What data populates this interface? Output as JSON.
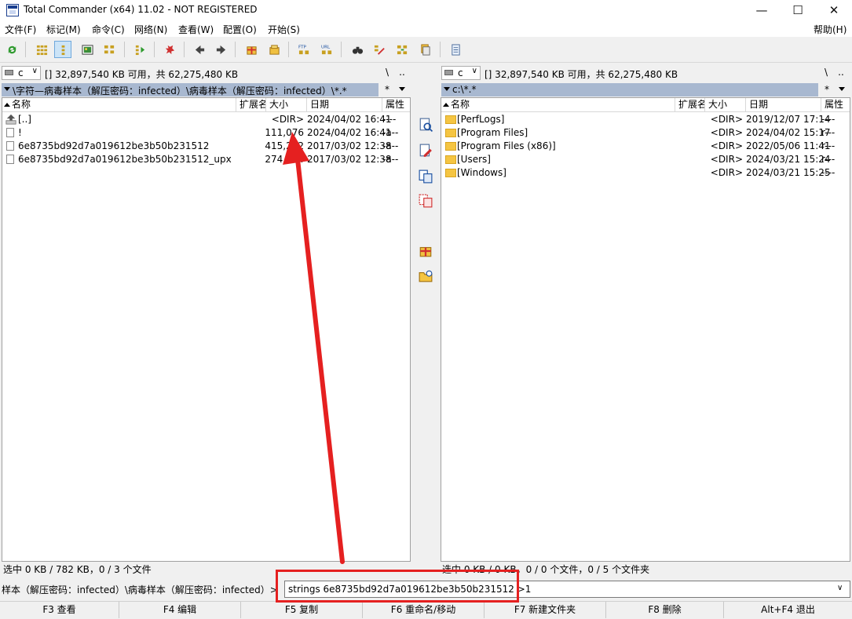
{
  "window": {
    "title": "Total Commander (x64) 11.02 - NOT REGISTERED",
    "minimize": "—",
    "maximize": "☐",
    "close": "✕"
  },
  "menu": {
    "items": [
      "文件(F)",
      "标记(M)",
      "命令(C)",
      "网络(N)",
      "查看(W)",
      "配置(O)",
      "开始(S)"
    ],
    "help": "帮助(H)"
  },
  "left": {
    "drive": "c",
    "free_space": "[]  32,897,540 KB 可用，共 62,275,480 KB",
    "root": "\\",
    "up": "..",
    "path": "\\字符—病毒样本（解压密码：infected）\\病毒样本（解压密码：infected）\\*.*",
    "filter": "*",
    "columns": {
      "name": "名称",
      "ext": "扩展名",
      "size": "大小",
      "date": "日期",
      "attr": "属性"
    },
    "files": [
      {
        "name": "[..]",
        "size": "<DIR>",
        "date": "2024/04/02 16:41",
        "attr": "----",
        "icon": "up-folder-icon"
      },
      {
        "name": "!",
        "size": "111,076",
        "date": "2024/04/02 16:41",
        "attr": "-a--",
        "icon": "file-icon"
      },
      {
        "name": "6e8735bd92d7a019612be3b50b231512",
        "size": "415,232",
        "date": "2017/03/02 12:38",
        "attr": "-a--",
        "icon": "file-icon"
      },
      {
        "name": "6e8735bd92d7a019612be3b50b231512_upx",
        "size": "274,944",
        "date": "2017/03/02 12:38",
        "attr": "-a--",
        "icon": "file-icon"
      }
    ],
    "status": "选中 0 KB / 782 KB，0 / 3 个文件"
  },
  "right": {
    "drive": "c",
    "free_space": "[]  32,897,540 KB 可用，共 62,275,480 KB",
    "root": "\\",
    "up": "..",
    "path": "c:\\*.*",
    "filter": "*",
    "columns": {
      "name": "名称",
      "ext": "扩展名",
      "size": "大小",
      "date": "日期",
      "attr": "属性"
    },
    "files": [
      {
        "name": "[PerfLogs]",
        "size": "<DIR>",
        "date": "2019/12/07 17:14",
        "attr": "----",
        "icon": "folder-icon"
      },
      {
        "name": "[Program Files]",
        "size": "<DIR>",
        "date": "2024/04/02 15:17",
        "attr": "r---",
        "icon": "folder-icon"
      },
      {
        "name": "[Program Files (x86)]",
        "size": "<DIR>",
        "date": "2022/05/06 11:41",
        "attr": "r---",
        "icon": "folder-icon"
      },
      {
        "name": "[Users]",
        "size": "<DIR>",
        "date": "2024/03/21 15:24",
        "attr": "r---",
        "icon": "folder-icon"
      },
      {
        "name": "[Windows]",
        "size": "<DIR>",
        "date": "2024/03/21 15:25",
        "attr": "----",
        "icon": "folder-icon"
      }
    ],
    "status": "选中 0 KB / 0 KB，0 / 0 个文件，0 / 5 个文件夹"
  },
  "command": {
    "prompt": "样本（解压密码：infected）\\病毒样本（解压密码：infected）>",
    "value": "strings 6e8735bd92d7a019612be3b50b231512 >1"
  },
  "fkeys": [
    "F3 查看",
    "F4 编辑",
    "F5 复制",
    "F6 重命名/移动",
    "F7 新建文件夹",
    "F8 删除",
    "Alt+F4 退出"
  ],
  "colors": {
    "annotation": "#e52020",
    "path_bar": "#a8b8d0",
    "folder": "#f5c542"
  }
}
